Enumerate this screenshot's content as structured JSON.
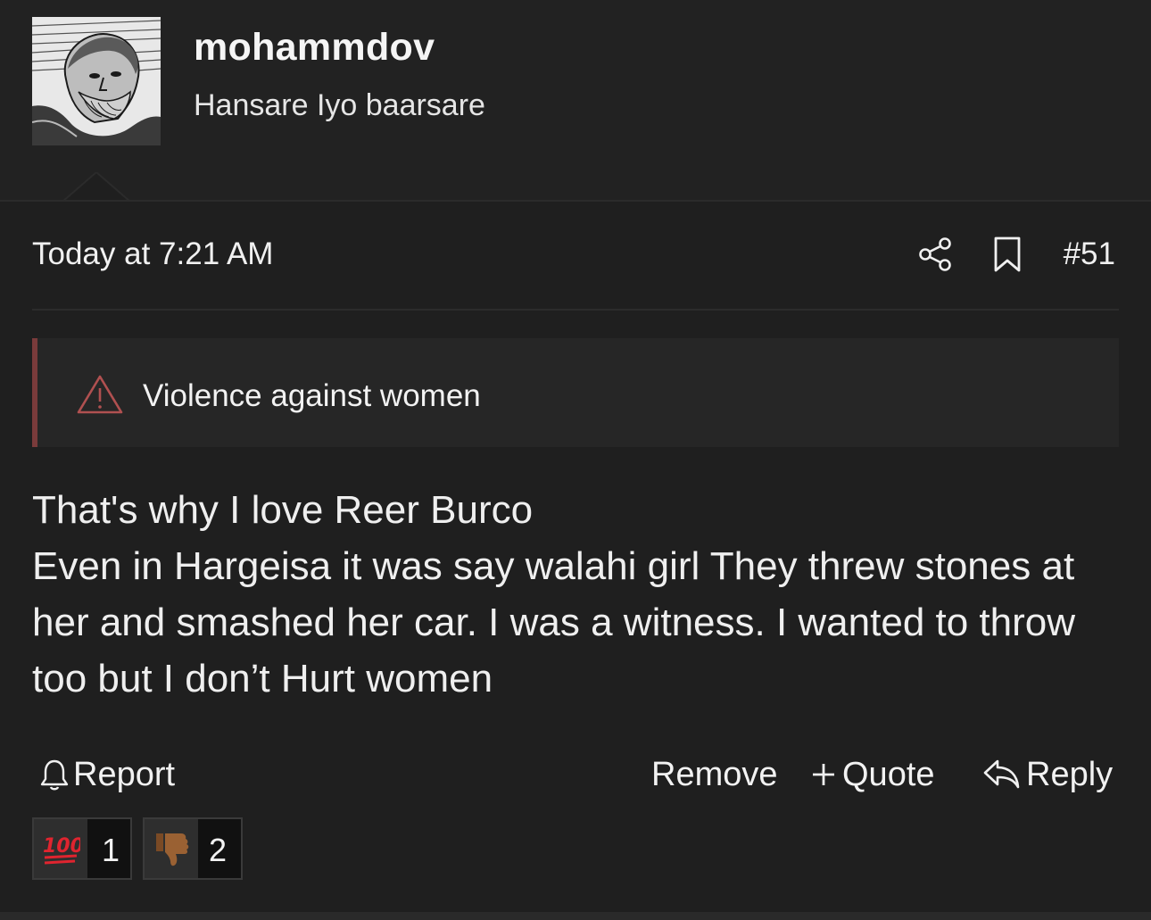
{
  "user": {
    "username": "mohammdov",
    "title": "Hansare Iyo baarsare",
    "avatar": "avatar-engraving-portrait"
  },
  "post": {
    "timestamp": "Today at 7:21 AM",
    "number": "#51",
    "share_icon": "share-icon",
    "bookmark_icon": "bookmark-icon",
    "warning": {
      "icon": "warning-triangle-icon",
      "text": "Violence against women",
      "accent_color": "#7a3b3b"
    },
    "body_lines": [
      "That's why I love Reer Burco",
      "Even in Hargeisa it was say walahi girl They threw stones at her and smashed her car. I was a witness. I wanted to throw too but I don’t Hurt women"
    ]
  },
  "actions": {
    "report": "Report",
    "remove": "Remove",
    "quote": "Quote",
    "reply": "Reply"
  },
  "reactions": [
    {
      "emoji": "💯",
      "icon": "hundred-points-icon",
      "count": "1"
    },
    {
      "emoji": "👎🏾",
      "icon": "thumbs-down-icon",
      "count": "2"
    }
  ]
}
